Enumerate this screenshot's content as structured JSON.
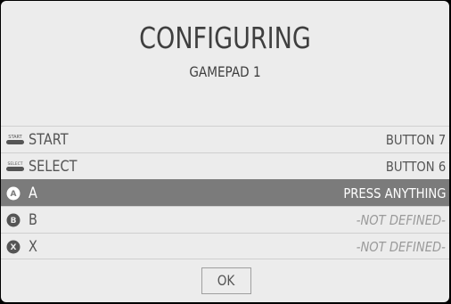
{
  "dialog": {
    "title": "CONFIGURING",
    "subtitle": "GAMEPAD 1",
    "ok_label": "OK"
  },
  "rows": [
    {
      "icon": "start-button-icon",
      "icon_text": "START",
      "label": "START",
      "value": "BUTTON 7",
      "selected": false
    },
    {
      "icon": "select-button-icon",
      "icon_text": "SELECT",
      "label": "SELECT",
      "value": "BUTTON 6",
      "selected": false
    },
    {
      "icon": "a-button-icon",
      "icon_text": "A",
      "label": "A",
      "value": "PRESS ANYTHING",
      "selected": true
    },
    {
      "icon": "b-button-icon",
      "icon_text": "B",
      "label": "B",
      "value": "-NOT DEFINED-",
      "selected": false
    },
    {
      "icon": "x-button-icon",
      "icon_text": "X",
      "label": "X",
      "value": "-NOT DEFINED-",
      "selected": false
    }
  ],
  "colors": {
    "background": "#ececec",
    "selected_row": "#7b7b7b",
    "text": "#555555"
  }
}
